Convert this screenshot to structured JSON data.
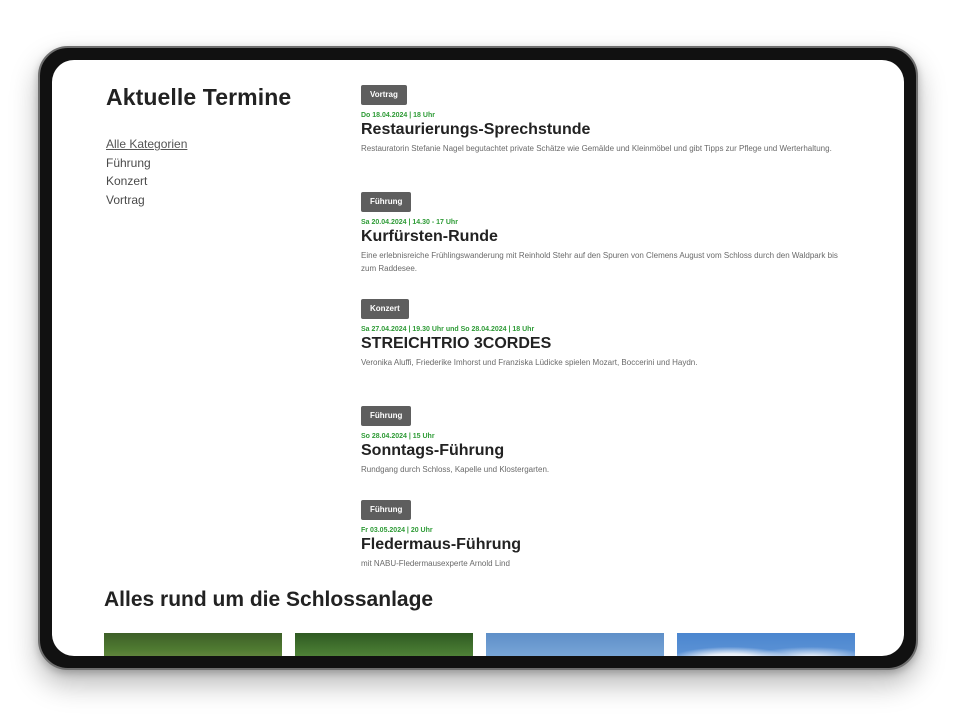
{
  "sidebar": {
    "title": "Aktuelle Termine",
    "categories": [
      {
        "label": "Alle Kategorien",
        "active": true
      },
      {
        "label": "Führung",
        "active": false
      },
      {
        "label": "Konzert",
        "active": false
      },
      {
        "label": "Vortrag",
        "active": false
      }
    ]
  },
  "events": [
    {
      "tag": "Vortrag",
      "date": "Do 18.04.2024 | 18 Uhr",
      "title": "Restaurierungs-Sprechstunde",
      "desc": "Restauratorin Stefanie Nagel begutachtet private Schätze wie Gemälde und Kleinmöbel und gibt Tipps zur Pflege und Werterhaltung."
    },
    {
      "tag": "Führung",
      "date": "Sa 20.04.2024 | 14.30 - 17 Uhr",
      "title": "Kurfürsten-Runde",
      "desc": "Eine erlebnisreiche Frühlingswanderung mit Reinhold Stehr auf den Spuren von Clemens August vom Schloss durch den Waldpark bis zum Raddesee."
    },
    {
      "tag": "Konzert",
      "date": "Sa 27.04.2024 | 19.30 Uhr und So 28.04.2024 | 18 Uhr",
      "title": "STREICHTRIO 3CORDES",
      "desc": "Veronika Aluffi, Friederike Imhorst und Franziska Lüdicke spielen Mozart, Boccerini und Haydn."
    },
    {
      "tag": "Führung",
      "date": "So 28.04.2024 | 15 Uhr",
      "title": "Sonntags-Führung",
      "desc": "Rundgang durch Schloss, Kapelle und Klostergarten."
    },
    {
      "tag": "Führung",
      "date": "Fr 03.05.2024 | 20 Uhr",
      "title": "Fledermaus-Führung",
      "desc": "mit NABU-Fledermausexperte Arnold Lind"
    }
  ],
  "section": {
    "title": "Alles rund um die Schlossanlage"
  },
  "colors": {
    "tag_bg": "#5e5e5e",
    "date_green": "#2e9b36",
    "text_dark": "#222222",
    "device_frame": "#111111"
  }
}
